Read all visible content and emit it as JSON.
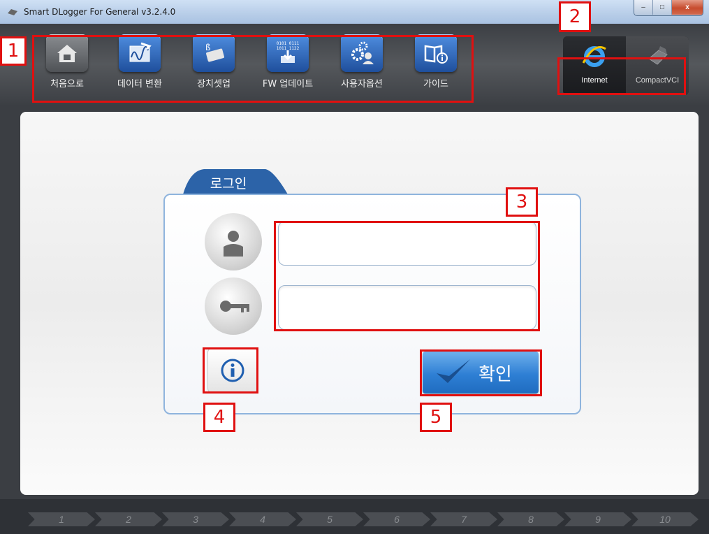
{
  "window": {
    "title": "Smart DLogger For General v3.2.4.0",
    "minimize": "–",
    "maximize": "□",
    "close": "x"
  },
  "toolbar": {
    "items": [
      {
        "label": "처음으로",
        "icon": "home-icon"
      },
      {
        "label": "데이터 변환",
        "icon": "data-convert-icon"
      },
      {
        "label": "장치셋업",
        "icon": "device-setup-icon"
      },
      {
        "label": "FW 업데이트",
        "icon": "firmware-update-icon"
      },
      {
        "label": "사용자옵션",
        "icon": "user-options-icon"
      },
      {
        "label": "가이드",
        "icon": "guide-icon"
      }
    ],
    "fw_icon_text1": "0101 0111",
    "fw_icon_text2": "1011 1122"
  },
  "connection": {
    "items": [
      {
        "label": "Internet",
        "icon": "internet-explorer-icon",
        "active": true
      },
      {
        "label": "CompactVCI",
        "icon": "compactvci-device-icon",
        "active": false
      }
    ]
  },
  "login": {
    "tab_label": "로그인",
    "user_placeholder": "",
    "password_placeholder": "",
    "confirm_label": "확인"
  },
  "annotations": [
    "1",
    "2",
    "3",
    "4",
    "5"
  ],
  "steps": [
    "1",
    "2",
    "3",
    "4",
    "5",
    "6",
    "7",
    "8",
    "9",
    "10"
  ],
  "colors": {
    "accent": "#2e7fd4",
    "annotation": "#e01010",
    "toolbar": "#45484c"
  }
}
